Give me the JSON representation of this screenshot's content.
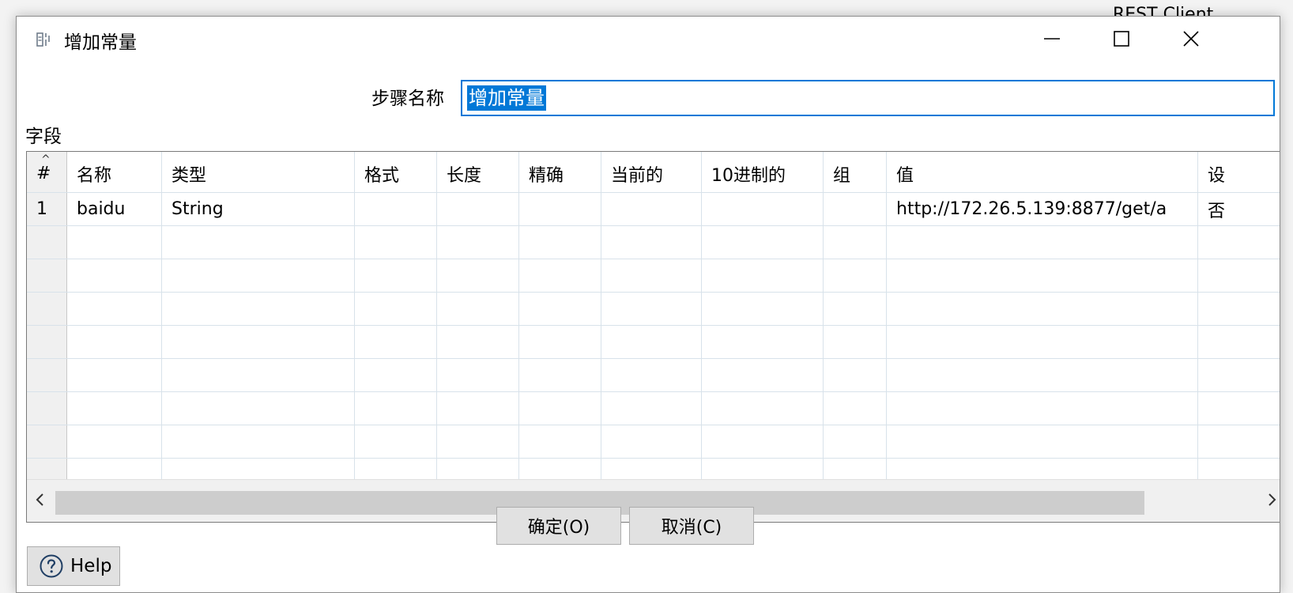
{
  "background_window": {
    "title": "REST Client"
  },
  "dialog": {
    "title": "增加常量",
    "step_name_label": "步骤名称",
    "step_name_value": "增加常量",
    "fields_label": "字段"
  },
  "table": {
    "columns": [
      "#",
      "名称",
      "类型",
      "格式",
      "长度",
      "精确",
      "当前的",
      "10进制的",
      "组",
      "值",
      "设"
    ],
    "rows": [
      [
        "1",
        "baidu",
        "String",
        "",
        "",
        "",
        "",
        "",
        "",
        "http://172.26.5.139:8877/get/a",
        "否"
      ]
    ]
  },
  "buttons": {
    "ok": "确定(O)",
    "cancel": "取消(C)",
    "help": "Help"
  },
  "colors": {
    "accent": "#0078d7",
    "button_face": "#e1e1e1",
    "grid_line": "#d8e2ea"
  },
  "icons": [
    "step-icon",
    "minimize-icon",
    "maximize-icon",
    "close-icon",
    "sort-up-icon",
    "scroll-left-icon",
    "scroll-right-icon",
    "help-circle-icon"
  ]
}
